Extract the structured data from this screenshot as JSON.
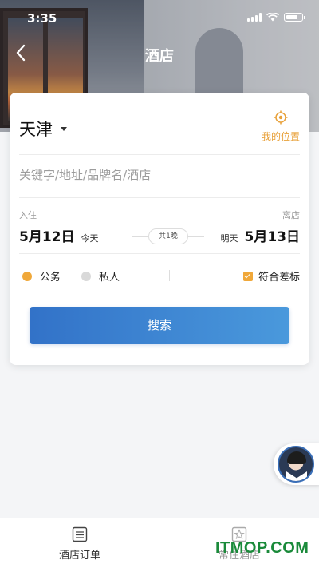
{
  "status_bar": {
    "time": "3:35"
  },
  "nav": {
    "title": "酒店",
    "back_icon": "chevron-left-icon"
  },
  "search": {
    "city": "天津",
    "location_label": "我的位置",
    "keyword_placeholder": "关键字/地址/品牌名/酒店",
    "checkin_label": "入住",
    "checkout_label": "离店",
    "checkin_date": "5月12日",
    "checkin_day": "今天",
    "checkout_date": "5月13日",
    "checkout_day": "明天",
    "nights": "共1晚",
    "options": {
      "business": "公务",
      "private": "私人",
      "policy": "符合差标"
    },
    "button": "搜索"
  },
  "colors": {
    "accent": "#f0a83a",
    "primary": "#3272c8"
  },
  "tabs": [
    {
      "label": "酒店订单",
      "icon": "list-icon"
    },
    {
      "label": "常住酒店",
      "icon": "star-icon"
    }
  ],
  "watermark": "ITMOP.COM"
}
